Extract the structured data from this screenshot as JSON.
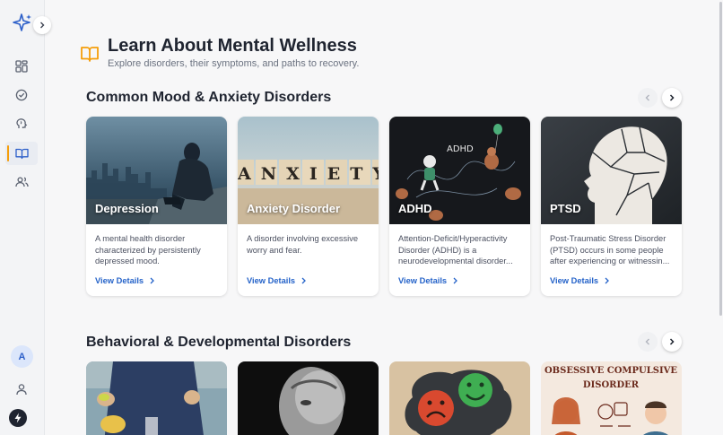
{
  "header": {
    "title": "Learn About Mental Wellness",
    "subtitle": "Explore disorders, their symptoms, and paths to recovery."
  },
  "sidebar": {
    "items": [
      {
        "name": "dashboard",
        "icon": "grid-icon"
      },
      {
        "name": "tasks",
        "icon": "check-circle-icon"
      },
      {
        "name": "wellness",
        "icon": "brain-icon"
      },
      {
        "name": "learn",
        "icon": "book-open-icon",
        "active": true
      },
      {
        "name": "community",
        "icon": "users-icon"
      }
    ],
    "avatar_initial": "A",
    "accent": "#f59e0b"
  },
  "sections": [
    {
      "title": "Common Mood & Anxiety Disorders",
      "cards": [
        {
          "title": "Depression",
          "description": "A mental health disorder characterized by persistently depressed mood.",
          "link": "View Details"
        },
        {
          "title": "Anxiety Disorder",
          "description": "A disorder involving excessive worry and fear.",
          "link": "View Details"
        },
        {
          "title": "ADHD",
          "description": "Attention-Deficit/Hyperactivity Disorder (ADHD) is a neurodevelopmental disorder...",
          "link": "View Details"
        },
        {
          "title": "PTSD",
          "description": "Post-Traumatic Stress Disorder (PTSD) occurs in some people after experiencing or witnessin...",
          "link": "View Details"
        }
      ]
    },
    {
      "title": "Behavioral & Developmental Disorders",
      "cards": [
        {
          "image": "binge-eating-photo"
        },
        {
          "image": "bw-portrait-photo"
        },
        {
          "image": "emoji-faces-photo"
        },
        {
          "image": "ocd-illustration",
          "image_text": "Obsessive Compulsive Disorder"
        }
      ]
    }
  ],
  "image_texts": {
    "anxiety_blocks": "ANXIETY",
    "adhd_label": "ADHD"
  },
  "colors": {
    "link": "#2563c9",
    "title": "#1f2430"
  }
}
